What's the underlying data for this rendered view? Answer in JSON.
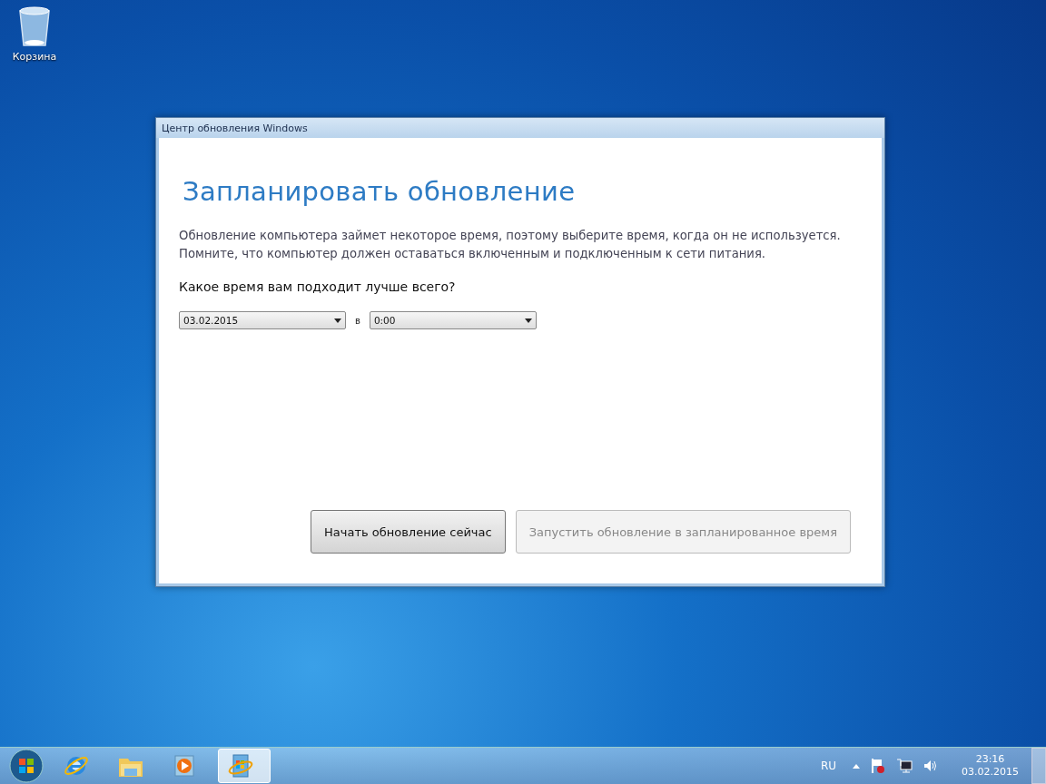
{
  "desktop_icons": [
    {
      "label": "Корзина",
      "kind": "recycle-bin"
    }
  ],
  "window": {
    "title": "Центр обновления Windows",
    "heading": "Запланировать обновление",
    "description": [
      "Обновление компьютера займет некоторое время, поэтому выберите время, когда он не используется.",
      "Помните, что компьютер должен оставаться включенным и подключенным к сети питания."
    ],
    "question": "Какое время вам подходит лучше всего?",
    "date_select": {
      "value": "03.02.2015"
    },
    "separator": "в",
    "time_select": {
      "value": "0:00"
    },
    "buttons": [
      {
        "label": "Начать обновление сейчас",
        "disabled": false
      },
      {
        "label": "Запустить обновление в запланированное время",
        "disabled": true
      }
    ]
  },
  "taskbar": {
    "apps": [
      {
        "kind": "browser",
        "selected": false
      },
      {
        "kind": "folder",
        "selected": false
      },
      {
        "kind": "media",
        "selected": false
      },
      {
        "kind": "update",
        "selected": true
      }
    ],
    "language": "RU",
    "time": "23:16",
    "date": "03.02.2015"
  }
}
